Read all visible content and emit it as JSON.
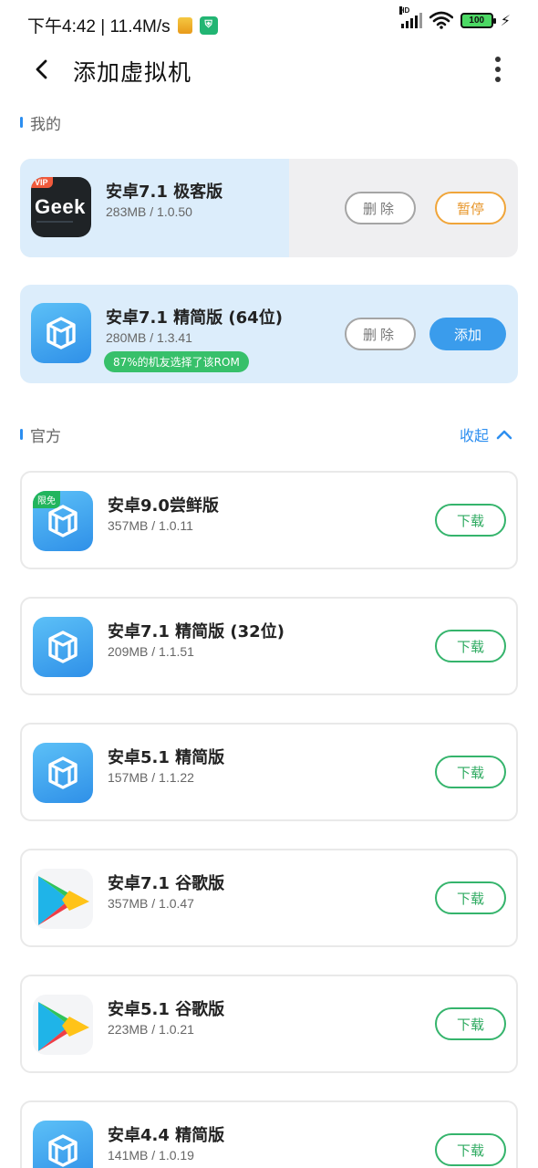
{
  "status_bar": {
    "time_speed": "下午4:42 | 11.4M/s",
    "signal_label": "HD",
    "battery": "100"
  },
  "header": {
    "title": "添加虚拟机"
  },
  "sections": {
    "mine": "我的",
    "official": "官方",
    "collapse": "收起"
  },
  "mine_items": [
    {
      "name": "安卓7.1 极客版",
      "meta": "283MB / 1.0.50",
      "icon": "geek-icon",
      "icon_badge": "VIP",
      "icon_text": "Geek",
      "progress": 0.54,
      "delete_label": "删除",
      "action_label": "暂停"
    },
    {
      "name": "安卓7.1 精简版 (64位)",
      "meta": "280MB / 1.3.41",
      "icon": "vm-cube-icon",
      "badge": "87%的机友选择了该ROM",
      "delete_label": "删除",
      "action_label": "添加"
    }
  ],
  "official_items": [
    {
      "name": "安卓9.0尝鲜版",
      "meta": "357MB / 1.0.11",
      "icon": "vm-cube-icon",
      "tag": "限免",
      "action_label": "下载"
    },
    {
      "name": "安卓7.1 精简版 (32位)",
      "meta": "209MB / 1.1.51",
      "icon": "vm-cube-icon",
      "action_label": "下载"
    },
    {
      "name": "安卓5.1 精简版",
      "meta": "157MB / 1.1.22",
      "icon": "vm-cube-icon",
      "action_label": "下载"
    },
    {
      "name": "安卓7.1 谷歌版",
      "meta": "357MB / 1.0.47",
      "icon": "google-play-icon",
      "action_label": "下载"
    },
    {
      "name": "安卓5.1 谷歌版",
      "meta": "223MB / 1.0.21",
      "icon": "google-play-icon",
      "action_label": "下载"
    },
    {
      "name": "安卓4.4 精简版",
      "meta": "141MB / 1.0.19",
      "icon": "vm-cube-icon",
      "action_label": "下载"
    }
  ],
  "colors": {
    "accent_blue": "#3a9cec",
    "download_green": "#35b46c",
    "pause_orange": "#f0a53a",
    "mine_card_bg": "#dcedfb"
  }
}
